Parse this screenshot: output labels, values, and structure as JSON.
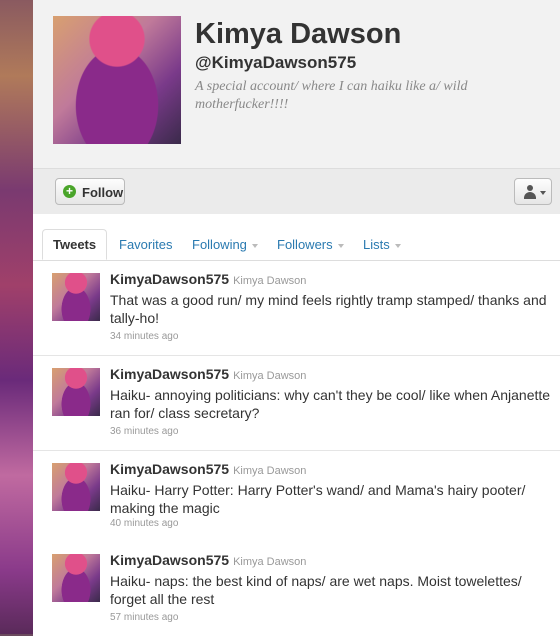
{
  "profile": {
    "name": "Kimya Dawson",
    "handle": "@KimyaDawson575",
    "bio": "A special account/ where I can haiku like a/ wild motherfucker!!!!"
  },
  "actions": {
    "follow_label": "Follow"
  },
  "tabs": [
    {
      "label": "Tweets",
      "active": true
    },
    {
      "label": "Favorites"
    },
    {
      "label": "Following"
    },
    {
      "label": "Followers"
    },
    {
      "label": "Lists"
    }
  ],
  "tweets": [
    {
      "username": "KimyaDawson575",
      "fullname": "Kimya Dawson",
      "text": "That was a good run/ my mind feels rightly tramp stamped/ thanks and tally-ho!",
      "time": "34 minutes ago"
    },
    {
      "username": "KimyaDawson575",
      "fullname": "Kimya Dawson",
      "text": "Haiku- annoying politicians: why can't they be cool/ like when Anjanette ran for/ class secretary?",
      "time": "36 minutes ago"
    },
    {
      "username": "KimyaDawson575",
      "fullname": "Kimya Dawson",
      "text": "Haiku- Harry Potter: Harry Potter's wand/ and Mama's hairy pooter/ making the magic",
      "time": "40 minutes ago"
    },
    {
      "username": "KimyaDawson575",
      "fullname": "Kimya Dawson",
      "text": "Haiku- naps: the best kind of naps/ are wet naps. Moist towelettes/ forget all the rest",
      "time": "57 minutes ago"
    }
  ],
  "colors": {
    "link": "#2a7ab0",
    "follow_icon": "#4aa52a"
  }
}
